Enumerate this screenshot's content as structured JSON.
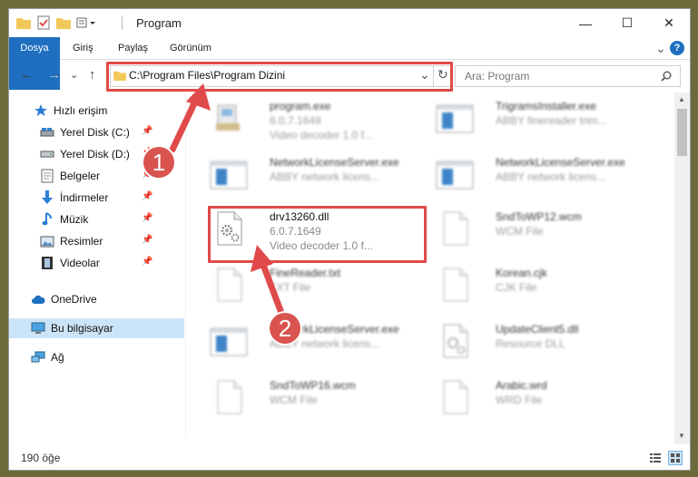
{
  "window": {
    "title": "Program",
    "controls": {
      "minimize": "—",
      "maximize": "☐",
      "close": "✕"
    }
  },
  "ribbon": {
    "tabs": [
      "Dosya",
      "Giriş",
      "Paylaş",
      "Görünüm"
    ],
    "expand": "⌄",
    "help": "?"
  },
  "address": {
    "path": "C:\\Program Files\\Program Dizini",
    "dropdown": "⌄",
    "refresh": "↻"
  },
  "search": {
    "placeholder": "Ara: Program"
  },
  "nav": {
    "back": "←",
    "forward": "→",
    "recent": "⌄",
    "up": "↑",
    "items": [
      {
        "label": "Hızlı erişim",
        "icon": "star-icon"
      },
      {
        "label": "Yerel Disk (C:)",
        "icon": "drive-icon",
        "pinned": true
      },
      {
        "label": "Yerel Disk (D:)",
        "icon": "drive-icon",
        "pinned": true
      },
      {
        "label": "Belgeler",
        "icon": "documents-icon",
        "pinned": true
      },
      {
        "label": "İndirmeler",
        "icon": "download-icon",
        "pinned": true
      },
      {
        "label": "Müzik",
        "icon": "music-icon",
        "pinned": true
      },
      {
        "label": "Resimler",
        "icon": "pictures-icon",
        "pinned": true
      },
      {
        "label": "Videolar",
        "icon": "videos-icon",
        "pinned": true
      },
      {
        "label": "OneDrive",
        "icon": "cloud-icon"
      },
      {
        "label": "Bu bilgisayar",
        "icon": "computer-icon",
        "selected": true
      },
      {
        "label": "Ağ",
        "icon": "network-icon"
      }
    ]
  },
  "files": [
    {
      "name": "program.exe",
      "line2": "6.0.7.1649",
      "line3": "Video decoder 1.0 f...",
      "icon": "installer-icon"
    },
    {
      "name": "TrigramsInstaller.exe",
      "line2": "ABBY finereader trim...",
      "line3": "",
      "icon": "app-window-icon"
    },
    {
      "name": "NetworkLicenseServer.exe",
      "line2": "ABBY network licens...",
      "line3": "",
      "icon": "app-window-icon"
    },
    {
      "name": "NetworkLicenseServer.exe",
      "line2": "ABBY network licens...",
      "line3": "",
      "icon": "app-window-icon"
    },
    {
      "name": "drv13260.dll",
      "line2": "6.0.7.1649",
      "line3": "Video decoder 1.0 f...",
      "icon": "dll-gear-icon"
    },
    {
      "name": "SndToWP12.wcm",
      "line2": "WCM File",
      "line3": "",
      "icon": "blank-file-icon"
    },
    {
      "name": "FineReader.txt",
      "line2": "TXT File",
      "line3": "",
      "icon": "blank-file-icon"
    },
    {
      "name": "Korean.cjk",
      "line2": "CJK File",
      "line3": "",
      "icon": "blank-file-icon"
    },
    {
      "name": "NetworkLicenseServer.exe",
      "line2": "ABBY network licens...",
      "line3": "",
      "icon": "app-window-icon"
    },
    {
      "name": "UpdateClient5.dll",
      "line2": "Resource DLL",
      "line3": "",
      "icon": "dll-gear-icon"
    },
    {
      "name": "SndToWP16.wcm",
      "line2": "WCM File",
      "line3": "",
      "icon": "blank-file-icon"
    },
    {
      "name": "Arabic.wrd",
      "line2": "WRD File",
      "line3": "",
      "icon": "blank-file-icon"
    }
  ],
  "status": {
    "count": "190 öğe"
  },
  "annotations": {
    "step1": "1",
    "step2": "2",
    "color": "#e04a4a"
  }
}
